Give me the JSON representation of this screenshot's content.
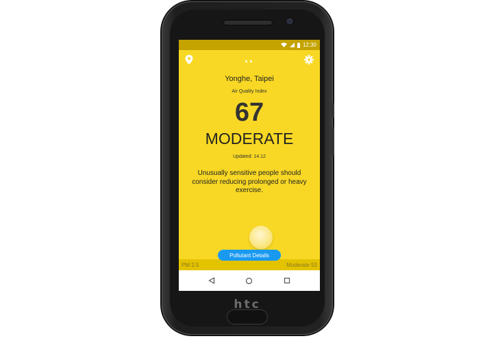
{
  "device": {
    "brand": "htc"
  },
  "status_bar": {
    "time": "12:30",
    "icons": [
      "wifi-icon",
      "signal-icon",
      "battery-icon"
    ]
  },
  "app": {
    "header": {
      "left_icon": "location-pin-icon",
      "right_icon": "gear-icon",
      "page_indicator_count": 2
    },
    "location": "Yonghe, Taipei",
    "aqi_label": "Air Quality Index",
    "aqi_value": "67",
    "aqi_status": "MODERATE",
    "updated": "Updated: 14.12",
    "advice": "Unusually sensitive people should consider reducing prolonged or heavy exercise.",
    "pollutant_button": "Pollutant Details",
    "bottom_bar": {
      "left": "PM 2.5",
      "right": "Moderate 53"
    },
    "colors": {
      "background": "#f8d824",
      "accent": "#1a99f0",
      "status_bar": "#c4a300"
    }
  },
  "nav_bar": {
    "icons": [
      "back-icon",
      "home-icon",
      "recents-icon"
    ]
  }
}
